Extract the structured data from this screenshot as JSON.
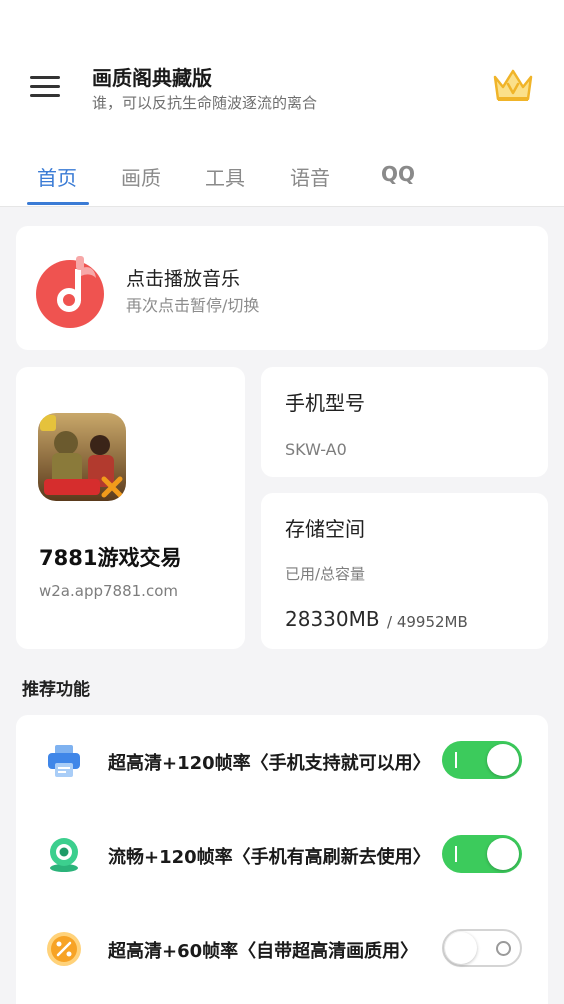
{
  "header": {
    "title": "画质阁典藏版",
    "subtitle": "谁，可以反抗生命随波逐流的离合",
    "menu_icon": "hamburger-menu-icon",
    "vip_icon": "crown-icon"
  },
  "tabs": [
    {
      "label": "首页",
      "active": true
    },
    {
      "label": "画质",
      "active": false
    },
    {
      "label": "工具",
      "active": false
    },
    {
      "label": "语音",
      "active": false
    },
    {
      "label": "QQ",
      "active": false
    }
  ],
  "music": {
    "title": "点击播放音乐",
    "subtitle": "再次点击暂停/切换",
    "icon": "music-note-icon"
  },
  "game": {
    "title": "7881游戏交易",
    "url": "w2a.app7881.com",
    "icon": "game-app-icon"
  },
  "phone": {
    "label": "手机型号",
    "model": "SKW-A0"
  },
  "storage": {
    "label": "存储空间",
    "sublabel": "已用/总容量",
    "used": "28330MB",
    "total": "/ 49952MB"
  },
  "features": {
    "section_title": "推荐功能",
    "items": [
      {
        "label": "超高清+120帧率〈手机支持就可以用〉",
        "enabled": true,
        "icon": "printer-icon"
      },
      {
        "label": "流畅+120帧率〈手机有高刷新去使用〉",
        "enabled": true,
        "icon": "webcam-icon"
      },
      {
        "label": "超高清+60帧率〈自带超高清画质用〉",
        "enabled": false,
        "icon": "percent-badge-icon"
      }
    ]
  },
  "colors": {
    "accent": "#3a7bd5",
    "toggle_on": "#3ccb5c",
    "music_red": "#ef5350",
    "crown_gold": "#f6c343"
  }
}
